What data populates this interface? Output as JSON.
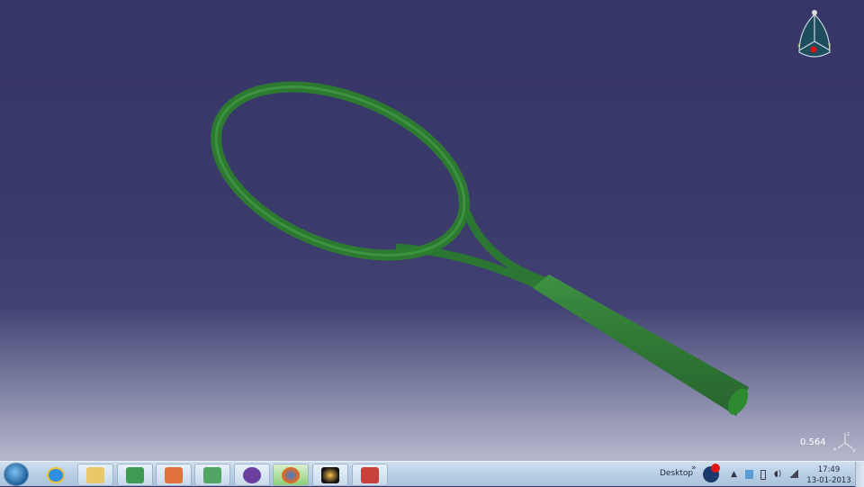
{
  "viewport": {
    "scale_value": "0.564",
    "compass_axes": [
      "x",
      "y",
      "z"
    ],
    "model": "tennis-racket",
    "model_color": "#2f8a2f",
    "background_top": "#363567"
  },
  "taskbar": {
    "start": "start-orb-icon",
    "apps": [
      {
        "name": "internet-explorer",
        "icon": "ie-icon",
        "color": "#2f8fe0"
      },
      {
        "name": "windows-explorer",
        "icon": "folder-icon",
        "color": "#e9c869"
      },
      {
        "name": "hp-photo",
        "icon": "hp-icon",
        "color": "#3f9a52"
      },
      {
        "name": "presentation",
        "icon": "slides-icon",
        "color": "#e2713d"
      },
      {
        "name": "scanner",
        "icon": "scanner-icon",
        "color": "#52a562"
      },
      {
        "name": "bittorrent",
        "icon": "bittorrent-icon",
        "color": "#6b3fa0"
      },
      {
        "name": "firefox",
        "icon": "firefox-icon",
        "color": "#e36b1c"
      },
      {
        "name": "media-app",
        "icon": "media-icon",
        "color": "#e79a2a"
      },
      {
        "name": "pdf-app",
        "icon": "pdf-icon",
        "color": "#c8403a"
      }
    ],
    "desktop_label": "Desktop",
    "chevron": "»",
    "clock": {
      "time": "17:49",
      "date": "13-01-2013"
    }
  }
}
